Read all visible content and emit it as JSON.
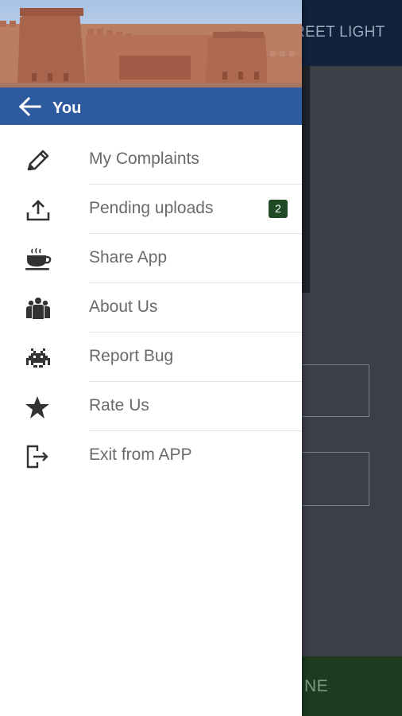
{
  "background": {
    "toolbar_title": "REET LIGHT",
    "submit_label": "NE"
  },
  "drawer": {
    "header": {
      "user_label": "You"
    },
    "menu": [
      {
        "label": "My Complaints",
        "icon": "pencil-icon"
      },
      {
        "label": "Pending uploads",
        "icon": "upload-icon",
        "badge": "2"
      },
      {
        "label": "Share App",
        "icon": "coffee-cup-icon"
      },
      {
        "label": "About Us",
        "icon": "group-icon"
      },
      {
        "label": "Report Bug",
        "icon": "space-invader-icon"
      },
      {
        "label": "Rate Us",
        "icon": "star-icon"
      },
      {
        "label": "Exit from APP",
        "icon": "exit-icon"
      }
    ]
  },
  "colors": {
    "drawer_header_bar": "#2e5b9f",
    "toolbar": "#10213a",
    "badge": "#1f4a24",
    "submit_bar": "#1d3b1f",
    "scrim_background": "#3b4048"
  }
}
